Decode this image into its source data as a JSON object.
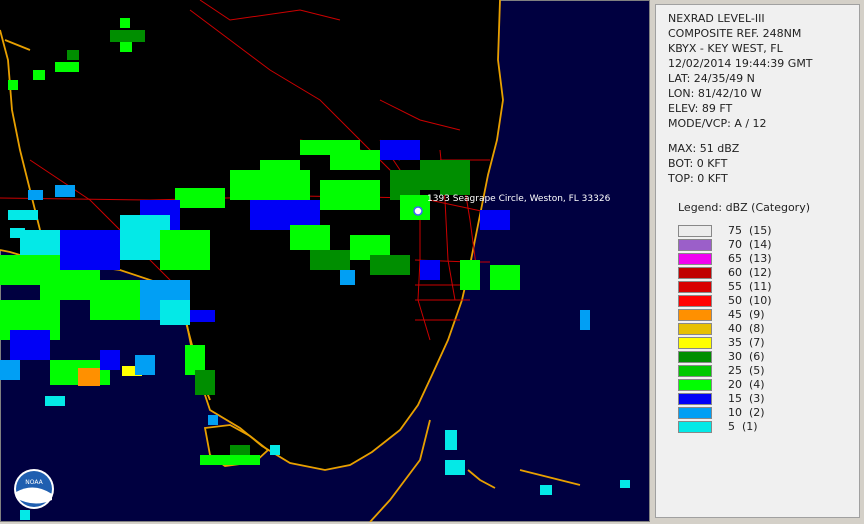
{
  "info": {
    "product": "NEXRAD LEVEL-III",
    "type": "COMPOSITE REF. 248NM",
    "station": "KBYX - KEY WEST, FL",
    "datetime": "12/02/2014 19:44:39 GMT",
    "lat": "LAT: 24/35/49 N",
    "lon": "LON: 81/42/10 W",
    "elev": "ELEV: 89 FT",
    "mode": "MODE/VCP: A / 12",
    "max": "MAX: 51 dBZ",
    "bot": "BOT: 0 KFT",
    "top": "TOP: 0 KFT"
  },
  "map": {
    "location_label": "1393 Seagrape Circle, Weston, FL 33326",
    "logo_text": "NOAA"
  },
  "legend": {
    "title": "Legend: dBZ (Category)",
    "items": [
      {
        "label": "75  (15)",
        "color": "#ececec"
      },
      {
        "label": "70  (14)",
        "color": "#9b5fc9"
      },
      {
        "label": "65  (13)",
        "color": "#f000f0"
      },
      {
        "label": "60  (12)",
        "color": "#c00000"
      },
      {
        "label": "55  (11)",
        "color": "#d80000"
      },
      {
        "label": "50  (10)",
        "color": "#ff0000"
      },
      {
        "label": "45  (9)",
        "color": "#ff9000"
      },
      {
        "label": "40  (8)",
        "color": "#e7c000"
      },
      {
        "label": "35  (7)",
        "color": "#ffff00"
      },
      {
        "label": "30  (6)",
        "color": "#008e00"
      },
      {
        "label": "25  (5)",
        "color": "#01c801"
      },
      {
        "label": "20  (4)",
        "color": "#02fd02"
      },
      {
        "label": "15  (3)",
        "color": "#0000f6"
      },
      {
        "label": "10  (2)",
        "color": "#019ff4"
      },
      {
        "label": "5  (1)",
        "color": "#04e9e7"
      }
    ]
  }
}
